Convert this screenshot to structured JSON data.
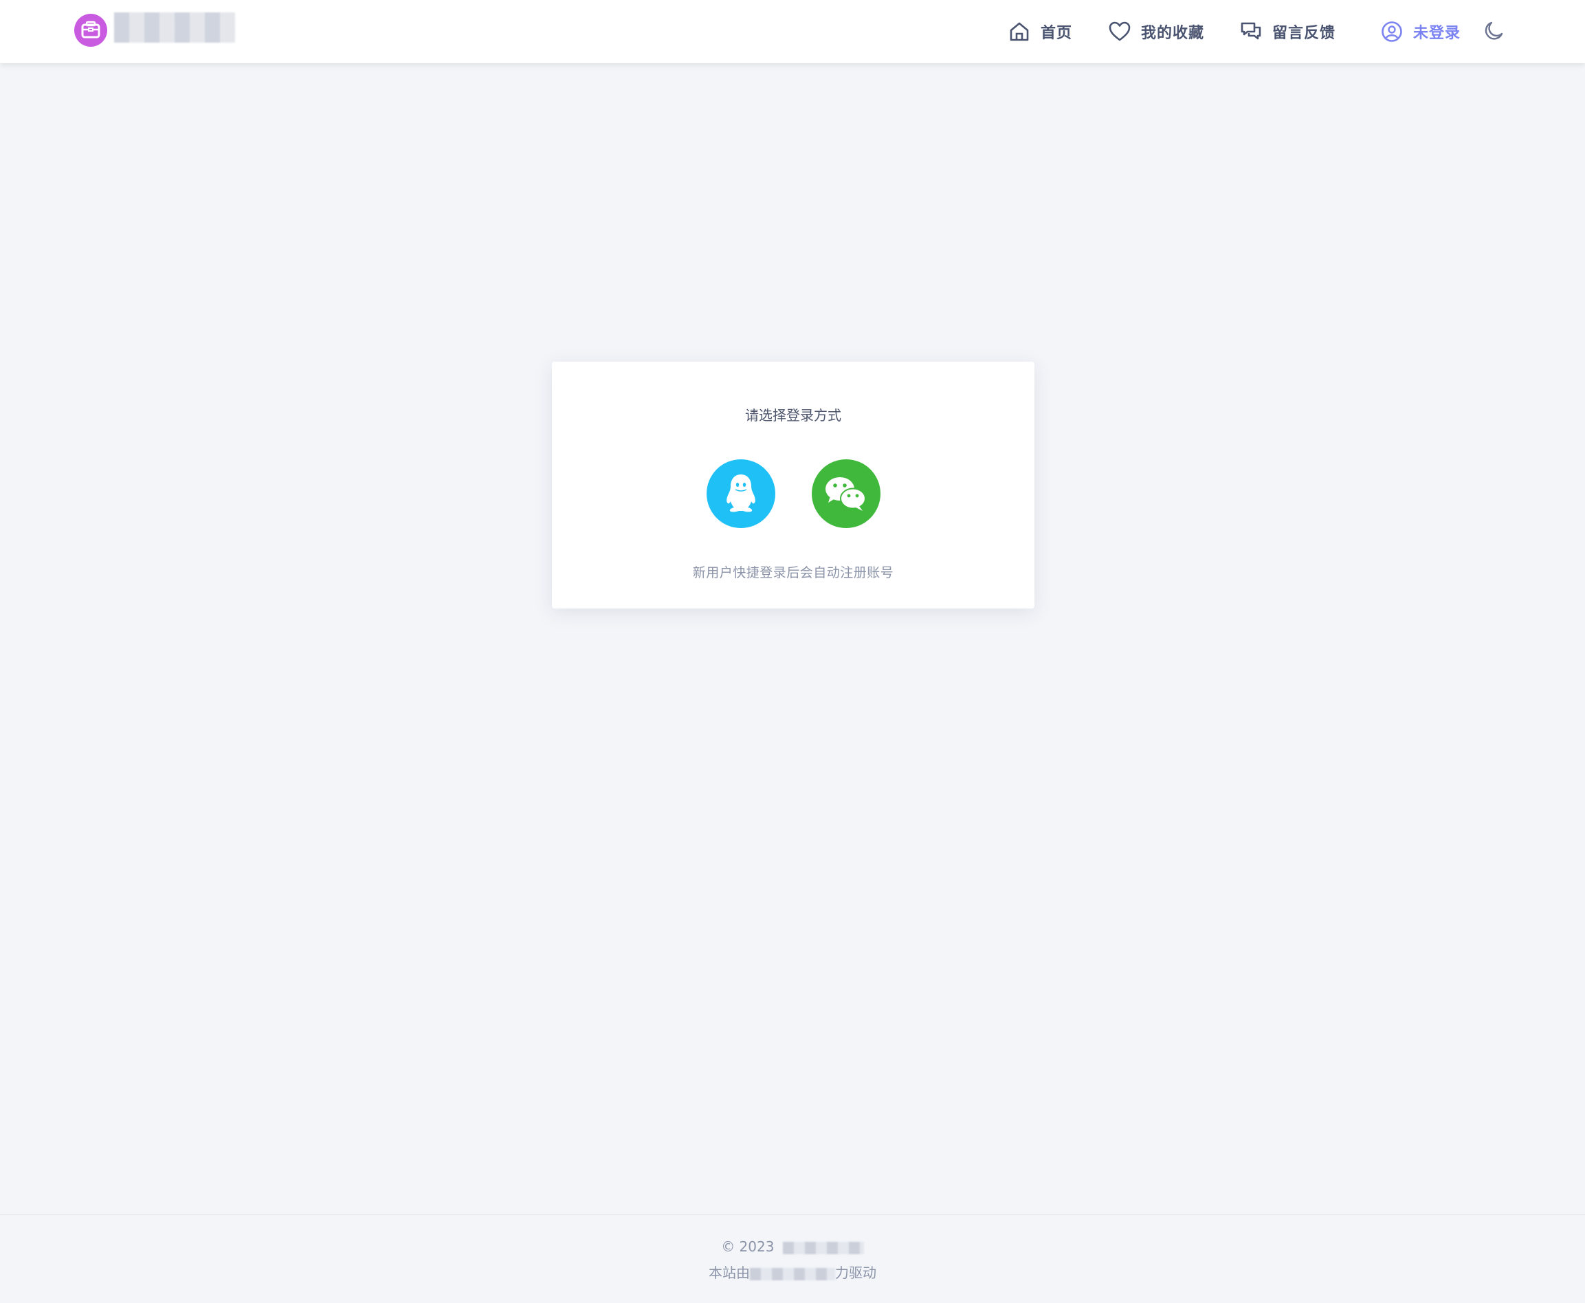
{
  "header": {
    "site_name": "",
    "nav": {
      "home": "首页",
      "favorites": "我的收藏",
      "feedback": "留言反馈",
      "login": "未登录"
    },
    "icons": {
      "logo": "toolbox-logo-icon",
      "home": "home-icon",
      "favorites": "heart-icon",
      "feedback": "chat-bubbles-icon",
      "login": "user-circle-icon",
      "theme": "moon-icon"
    }
  },
  "login_card": {
    "title": "请选择登录方式",
    "qq_icon": "qq-penguin-icon",
    "wechat_icon": "wechat-icon",
    "tip": "新用户快捷登录后会自动注册账号"
  },
  "footer": {
    "copyright_prefix": "© 2023",
    "powered_prefix": "本站由",
    "powered_suffix": "力驱动"
  },
  "colors": {
    "page_bg": "#f3f5f9",
    "brand_logo": "#c95be0",
    "login_accent": "#7b83f2",
    "qq": "#1ec0f5",
    "wechat": "#3fb83b",
    "nav_text": "#4a5470"
  }
}
